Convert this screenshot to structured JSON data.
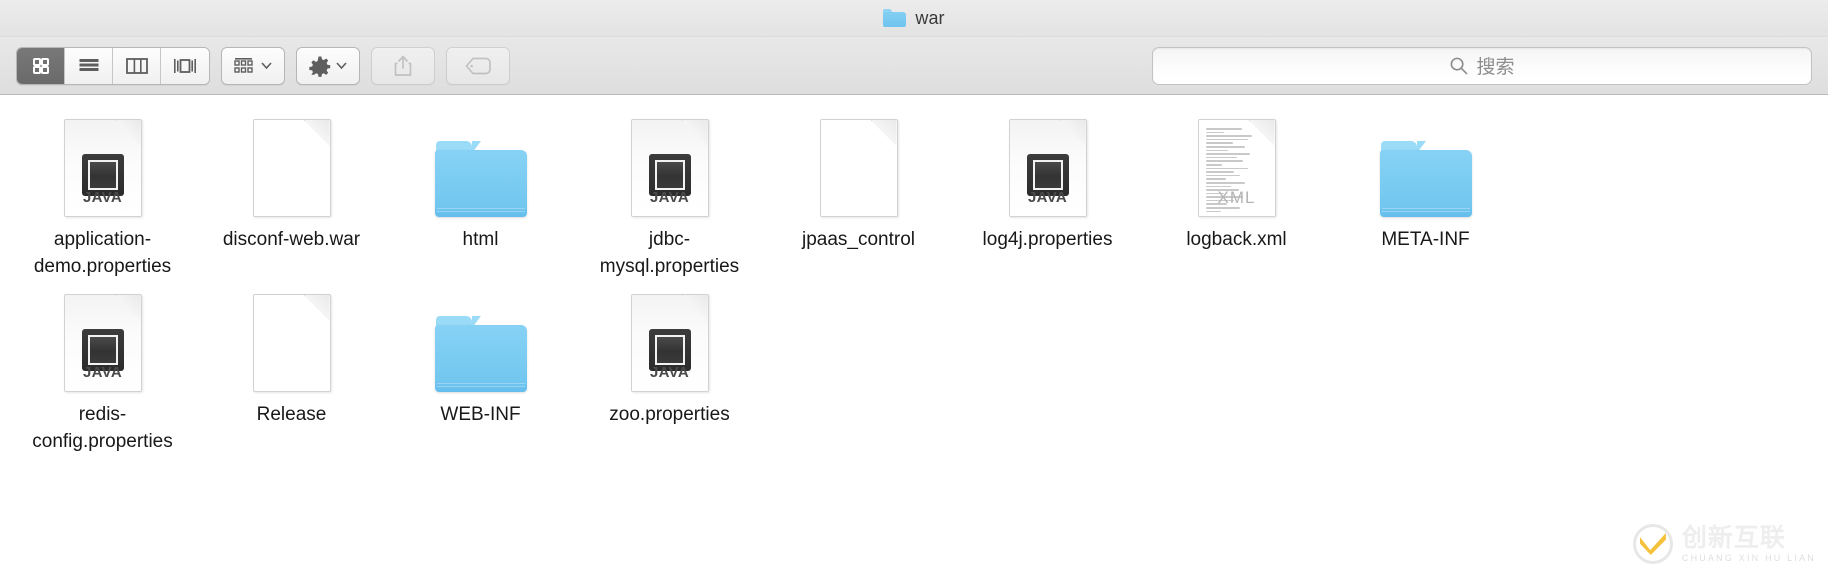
{
  "window": {
    "title": "war",
    "title_icon": "folder-icon"
  },
  "toolbar": {
    "view_modes": [
      {
        "name": "icon-view",
        "icon": "grid-icon",
        "active": true
      },
      {
        "name": "list-view",
        "icon": "list-icon",
        "active": false
      },
      {
        "name": "column-view",
        "icon": "columns-icon",
        "active": false
      },
      {
        "name": "coverflow-view",
        "icon": "coverflow-icon",
        "active": false
      }
    ],
    "arrange_button": {
      "name": "arrange-by-button",
      "icon": "arrange-icon",
      "label": ""
    },
    "action_button": {
      "name": "action-gear-button",
      "icon": "gear-icon",
      "label": ""
    },
    "share_button": {
      "name": "share-button",
      "icon": "share-icon",
      "disabled": true
    },
    "tag_button": {
      "name": "tag-button",
      "icon": "tag-icon",
      "disabled": true
    }
  },
  "search": {
    "placeholder": "搜索",
    "value": "",
    "icon": "search-icon"
  },
  "files": [
    {
      "name": "application-demo.properties",
      "kind": "java-document",
      "type_label": "JAVA"
    },
    {
      "name": "disconf-web.war",
      "kind": "blank-document",
      "type_label": ""
    },
    {
      "name": "html",
      "kind": "folder",
      "type_label": ""
    },
    {
      "name": "jdbc-mysql.properties",
      "kind": "java-document",
      "type_label": "JAVA"
    },
    {
      "name": "jpaas_control",
      "kind": "blank-document",
      "type_label": ""
    },
    {
      "name": "log4j.properties",
      "kind": "java-document",
      "type_label": "JAVA"
    },
    {
      "name": "logback.xml",
      "kind": "xml-document",
      "type_label": "XML"
    },
    {
      "name": "META-INF",
      "kind": "folder",
      "type_label": ""
    },
    {
      "name": "redis-config.properties",
      "kind": "java-document",
      "type_label": "JAVA"
    },
    {
      "name": "Release",
      "kind": "blank-document",
      "type_label": ""
    },
    {
      "name": "WEB-INF",
      "kind": "folder",
      "type_label": ""
    },
    {
      "name": "zoo.properties",
      "kind": "java-document",
      "type_label": "JAVA"
    }
  ],
  "watermark": {
    "cn": "创新互联",
    "pinyin": "CHUANG XIN HU LIAN"
  },
  "colors": {
    "folder_blue": "#72c7f0",
    "accent_yellow": "#f5bb2a",
    "toolbar_bg": "#e3e3e3",
    "active_segment": "#6a6a6a"
  }
}
